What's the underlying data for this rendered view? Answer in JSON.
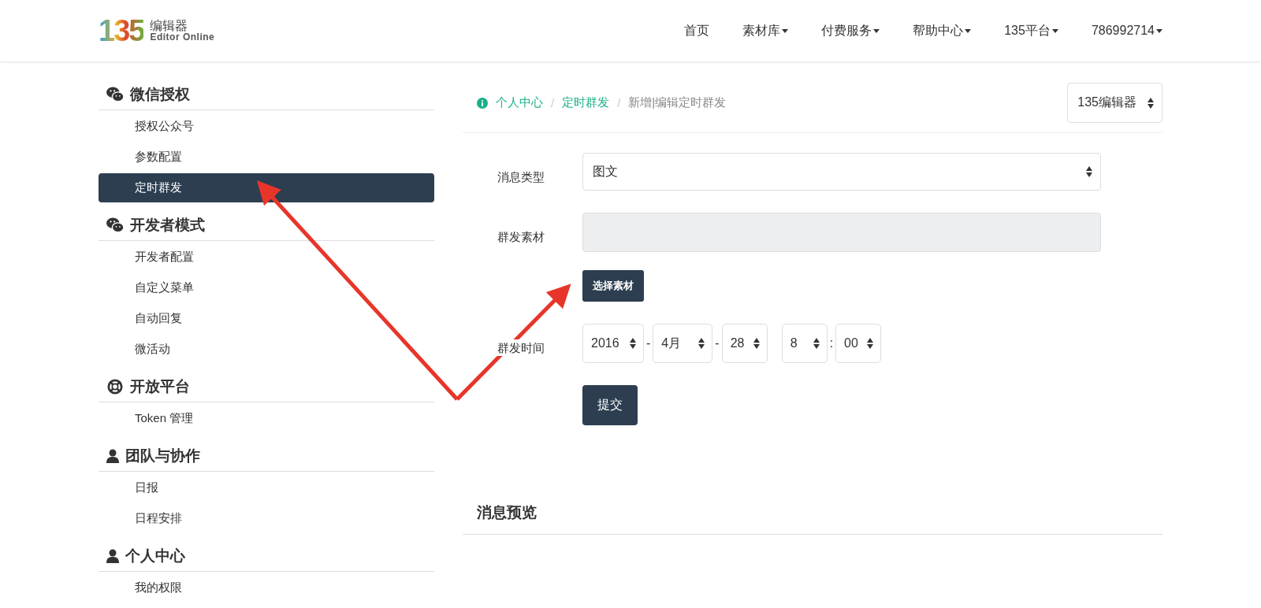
{
  "logo": {
    "mark": "135",
    "title": "编辑器",
    "subtitle": "Editor Online"
  },
  "nav": [
    {
      "label": "首页",
      "dropdown": false
    },
    {
      "label": "素材库",
      "dropdown": true
    },
    {
      "label": "付费服务",
      "dropdown": true
    },
    {
      "label": "帮助中心",
      "dropdown": true
    },
    {
      "label": "135平台",
      "dropdown": true
    },
    {
      "label": "786992714",
      "dropdown": true
    }
  ],
  "sidebar": [
    {
      "title": "微信授权",
      "kind": "wechat",
      "items": [
        {
          "label": "授权公众号",
          "selected": false
        },
        {
          "label": "参数配置",
          "selected": false
        },
        {
          "label": "定时群发",
          "selected": true
        }
      ]
    },
    {
      "title": "开发者模式",
      "kind": "wechat",
      "items": [
        {
          "label": "开发者配置",
          "selected": false
        },
        {
          "label": "自定义菜单",
          "selected": false
        },
        {
          "label": "自动回复",
          "selected": false
        },
        {
          "label": "微活动",
          "selected": false
        }
      ]
    },
    {
      "title": "开放平台",
      "kind": "lifebuoy",
      "items": [
        {
          "label": "Token 管理",
          "selected": false
        }
      ]
    },
    {
      "title": "团队与协作",
      "kind": "user",
      "items": [
        {
          "label": "日报",
          "selected": false
        },
        {
          "label": "日程安排",
          "selected": false
        }
      ]
    },
    {
      "title": "个人中心",
      "kind": "user",
      "items": [
        {
          "label": "我的权限",
          "selected": false
        }
      ]
    }
  ],
  "breadcrumb_separator": "/",
  "breadcrumb": [
    {
      "label": "个人中心",
      "link": true
    },
    {
      "label": "定时群发",
      "link": true
    },
    {
      "label": "新增|编辑定时群发",
      "link": false
    }
  ],
  "account_select": {
    "value": "135编辑器"
  },
  "form": {
    "message_type": {
      "label": "消息类型",
      "value": "图文"
    },
    "material": {
      "label": "群发素材",
      "disabled": true,
      "button": "选择素材"
    },
    "send_time": {
      "label": "群发时间",
      "date_separator": "-",
      "time_separator": ":",
      "year": "2016",
      "month": "4月",
      "day": "28",
      "hour": "8",
      "minute": "00"
    },
    "submit": "提交"
  },
  "preview": {
    "title": "消息预览"
  }
}
